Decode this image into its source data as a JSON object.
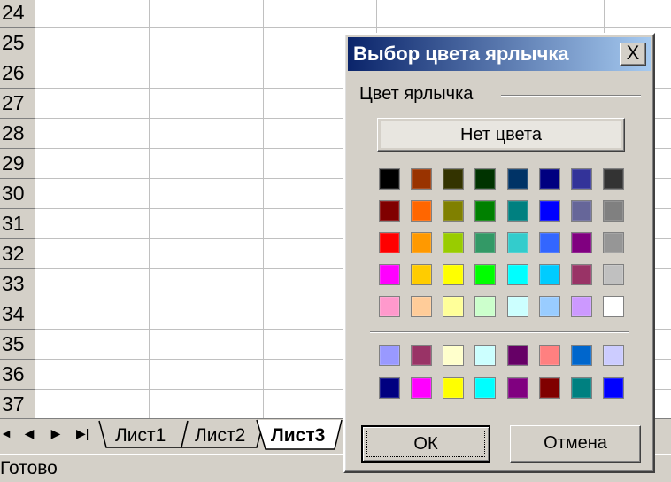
{
  "spreadsheet": {
    "row_numbers": [
      "24",
      "25",
      "26",
      "27",
      "28",
      "29",
      "30",
      "31",
      "32",
      "33",
      "34",
      "35",
      "36",
      "37"
    ],
    "sheet_tabs": [
      "Лист1",
      "Лист2",
      "Лист3"
    ],
    "active_sheet": "Лист3",
    "nav_buttons": [
      "first-sheet",
      "previous-sheet",
      "next-sheet",
      "last-sheet"
    ]
  },
  "status_bar": {
    "text": "Готово"
  },
  "dialog": {
    "title": "Выбор цвета ярлычка",
    "close_label": "X",
    "group_label": "Цвет ярлычка",
    "no_color_label": "Нет цвета",
    "ok_label": "ОК",
    "cancel_label": "Отмена",
    "palette_main": [
      [
        "#000000",
        "#993300",
        "#333300",
        "#003300",
        "#003366",
        "#000080",
        "#333399",
        "#333333"
      ],
      [
        "#800000",
        "#FF6600",
        "#808000",
        "#008000",
        "#008080",
        "#0000FF",
        "#666699",
        "#808080"
      ],
      [
        "#FF0000",
        "#FF9900",
        "#99CC00",
        "#339966",
        "#33CCCC",
        "#3366FF",
        "#800080",
        "#969696"
      ],
      [
        "#FF00FF",
        "#FFCC00",
        "#FFFF00",
        "#00FF00",
        "#00FFFF",
        "#00CCFF",
        "#993366",
        "#C0C0C0"
      ],
      [
        "#FF99CC",
        "#FFCC99",
        "#FFFF99",
        "#CCFFCC",
        "#CCFFFF",
        "#99CCFF",
        "#CC99FF",
        "#FFFFFF"
      ]
    ],
    "palette_extra": [
      [
        "#9999FF",
        "#993366",
        "#FFFFCC",
        "#CCFFFF",
        "#660066",
        "#FF8080",
        "#0066CC",
        "#CCCCFF"
      ],
      [
        "#000080",
        "#FF00FF",
        "#FFFF00",
        "#00FFFF",
        "#800080",
        "#800000",
        "#008080",
        "#0000FF"
      ]
    ]
  }
}
